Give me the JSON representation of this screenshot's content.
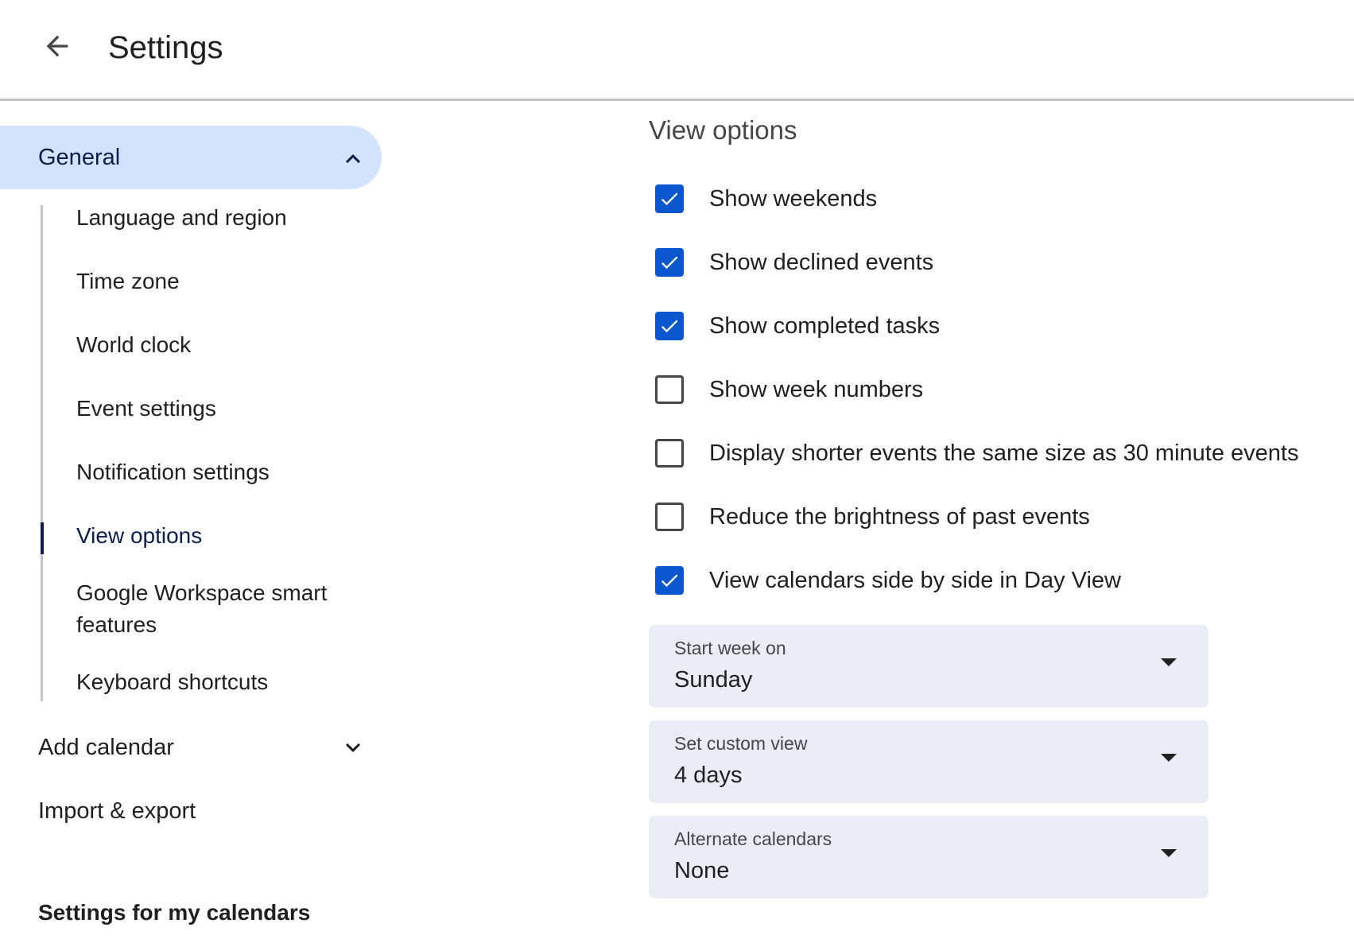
{
  "header": {
    "title": "Settings",
    "back_icon": "arrow-back-icon"
  },
  "sidebar": {
    "general": {
      "label": "General",
      "expanded": true,
      "icon": "chevron-up-icon"
    },
    "general_items": [
      {
        "label": "Language and region"
      },
      {
        "label": "Time zone"
      },
      {
        "label": "World clock"
      },
      {
        "label": "Event settings"
      },
      {
        "label": "Notification settings"
      },
      {
        "label": "View options",
        "active": true
      },
      {
        "label": "Google Workspace smart features"
      },
      {
        "label": "Keyboard shortcuts"
      }
    ],
    "add_calendar": {
      "label": "Add calendar",
      "icon": "chevron-down-icon"
    },
    "import_export": {
      "label": "Import & export"
    },
    "settings_for_my_calendars": "Settings for my calendars"
  },
  "main": {
    "title": "View options",
    "options": [
      {
        "label": "Show weekends",
        "checked": true
      },
      {
        "label": "Show declined events",
        "checked": true
      },
      {
        "label": "Show completed tasks",
        "checked": true
      },
      {
        "label": "Show week numbers",
        "checked": false
      },
      {
        "label": "Display shorter events the same size as 30 minute events",
        "checked": false
      },
      {
        "label": "Reduce the brightness of past events",
        "checked": false
      },
      {
        "label": "View calendars side by side in Day View",
        "checked": true
      }
    ],
    "selects": [
      {
        "label": "Start week on",
        "value": "Sunday"
      },
      {
        "label": "Set custom view",
        "value": "4 days"
      },
      {
        "label": "Alternate calendars",
        "value": "None"
      }
    ]
  },
  "colors": {
    "accent": "#0b57d0",
    "nav_active_bg": "#d3e3fd",
    "nav_active_text": "#0b1d4d",
    "select_bg": "#e9eef6"
  }
}
